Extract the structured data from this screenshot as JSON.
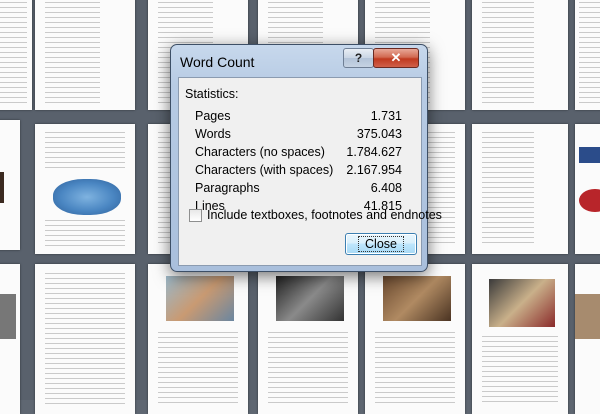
{
  "dialog": {
    "title": "Word Count",
    "help_label": "?",
    "close_x_label": "✕",
    "statistics_heading": "Statistics:",
    "stats": [
      {
        "label": "Pages",
        "value": "1.731"
      },
      {
        "label": "Words",
        "value": "375.043"
      },
      {
        "label": "Characters (no spaces)",
        "value": "1.784.627"
      },
      {
        "label": "Characters (with spaces)",
        "value": "2.167.954"
      },
      {
        "label": "Paragraphs",
        "value": "6.408"
      },
      {
        "label": "Lines",
        "value": "41.815"
      }
    ],
    "include_checkbox_label": "Include textboxes, footnotes and endnotes",
    "include_checked": false,
    "close_button_label": "Close"
  }
}
